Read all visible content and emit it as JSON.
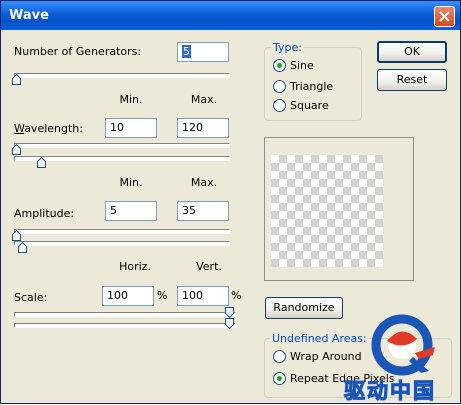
{
  "window": {
    "title": "Wave"
  },
  "generators": {
    "label": "Number of Generators:",
    "value": "5",
    "level": 0
  },
  "header1": {
    "min": "Min.",
    "max": "Max."
  },
  "wavelength": {
    "label": "Wavelength:",
    "min": "10",
    "max": "120",
    "min_level": 0,
    "max_level": 0.12
  },
  "header2": {
    "min": "Min.",
    "max": "Max."
  },
  "amplitude": {
    "label": "Amplitude:",
    "min": "5",
    "max": "35",
    "min_level": 0,
    "max_level": 0.03
  },
  "header3": {
    "horiz": "Horiz.",
    "vert": "Vert."
  },
  "scale": {
    "label": "Scale:",
    "horiz": "100",
    "vert": "100",
    "unit": "%",
    "horiz_level": 1,
    "vert_level": 1
  },
  "type_group": {
    "title": "Type:",
    "options": [
      {
        "label": "Sine",
        "selected": true
      },
      {
        "label": "Triangle",
        "selected": false
      },
      {
        "label": "Square",
        "selected": false
      }
    ]
  },
  "buttons": {
    "ok": "OK",
    "reset": "Reset",
    "randomize": "Randomize"
  },
  "undefined_areas": {
    "title": "Undefined Areas:",
    "options": [
      {
        "label": "Wrap Around",
        "selected": false
      },
      {
        "label": "Repeat Edge Pixels",
        "selected": true
      }
    ]
  },
  "watermark": {
    "text": "驱动中国"
  },
  "colors": {
    "title_bar": "#0a5fd8",
    "dialog_bg": "#ece9d8",
    "group_title": "#0046d5",
    "radio_dot": "#21a121"
  }
}
